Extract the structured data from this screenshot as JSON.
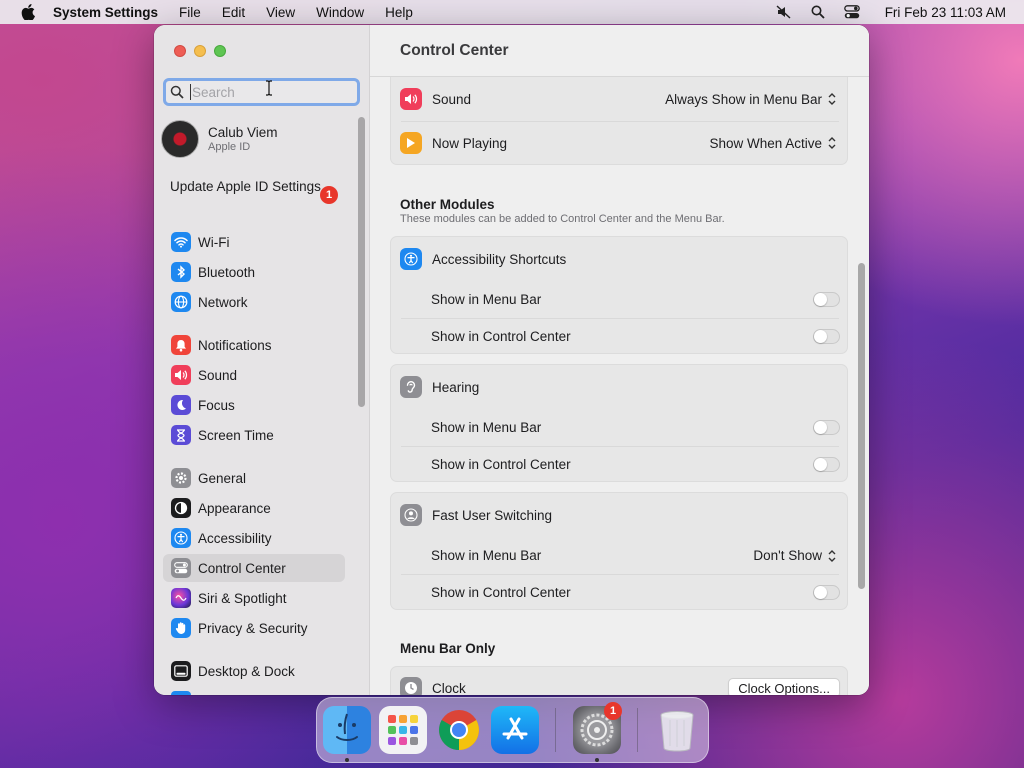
{
  "menubar": {
    "app_name": "System Settings",
    "menus": [
      "File",
      "Edit",
      "View",
      "Window",
      "Help"
    ],
    "clock": "Fri Feb 23  11:03 AM"
  },
  "sidebar": {
    "search_placeholder": "Search",
    "profile": {
      "name": "Calub Viem",
      "subtitle": "Apple ID"
    },
    "update": {
      "label": "Update Apple ID Settings",
      "badge": "1"
    },
    "items": [
      {
        "label": "Wi-Fi",
        "icon": "wifi-icon",
        "color": "#1e88f0"
      },
      {
        "label": "Bluetooth",
        "icon": "bluetooth-icon",
        "color": "#1e88f0"
      },
      {
        "label": "Network",
        "icon": "globe-icon",
        "color": "#1e88f0"
      },
      {
        "label": "Notifications",
        "icon": "bell-icon",
        "color": "#f0443a"
      },
      {
        "label": "Sound",
        "icon": "speaker-icon",
        "color": "#f03e5a"
      },
      {
        "label": "Focus",
        "icon": "moon-icon",
        "color": "#5b4bd6"
      },
      {
        "label": "Screen Time",
        "icon": "hourglass-icon",
        "color": "#5b4bd6"
      },
      {
        "label": "General",
        "icon": "gear-icon",
        "color": "#8e8e93"
      },
      {
        "label": "Appearance",
        "icon": "appearance-icon",
        "color": "#1c1c1e"
      },
      {
        "label": "Accessibility",
        "icon": "accessibility-icon",
        "color": "#1e88f0"
      },
      {
        "label": "Control Center",
        "icon": "control-center-icon",
        "color": "#8e8e93"
      },
      {
        "label": "Siri & Spotlight",
        "icon": "siri-icon",
        "color": "#5a2ea6"
      },
      {
        "label": "Privacy & Security",
        "icon": "hand-icon",
        "color": "#1e88f0"
      },
      {
        "label": "Desktop & Dock",
        "icon": "dock-icon",
        "color": "#1c1c1e"
      }
    ]
  },
  "main": {
    "title": "Control Center",
    "top_rows": [
      {
        "label": "Sound",
        "value": "Always Show in Menu Bar"
      },
      {
        "label": "Now Playing",
        "value": "Show When Active"
      }
    ],
    "other_modules": {
      "title": "Other Modules",
      "subtitle": "These modules can be added to Control Center and the Menu Bar.",
      "modules": [
        {
          "label": "Accessibility Shortcuts",
          "menu_bar": "Show in Menu Bar",
          "control_center": "Show in Control Center"
        },
        {
          "label": "Hearing",
          "menu_bar": "Show in Menu Bar",
          "control_center": "Show in Control Center"
        },
        {
          "label": "Fast User Switching",
          "menu_bar": "Show in Menu Bar",
          "menu_bar_value": "Don't Show",
          "control_center": "Show in Control Center"
        }
      ]
    },
    "menu_bar_only": {
      "title": "Menu Bar Only",
      "clock_label": "Clock",
      "clock_button": "Clock Options..."
    }
  },
  "dock": {
    "badge": "1",
    "apps": [
      "finder-icon",
      "launchpad-icon",
      "chrome-icon",
      "app-store-icon",
      "system-settings-icon",
      "trash-icon"
    ]
  }
}
